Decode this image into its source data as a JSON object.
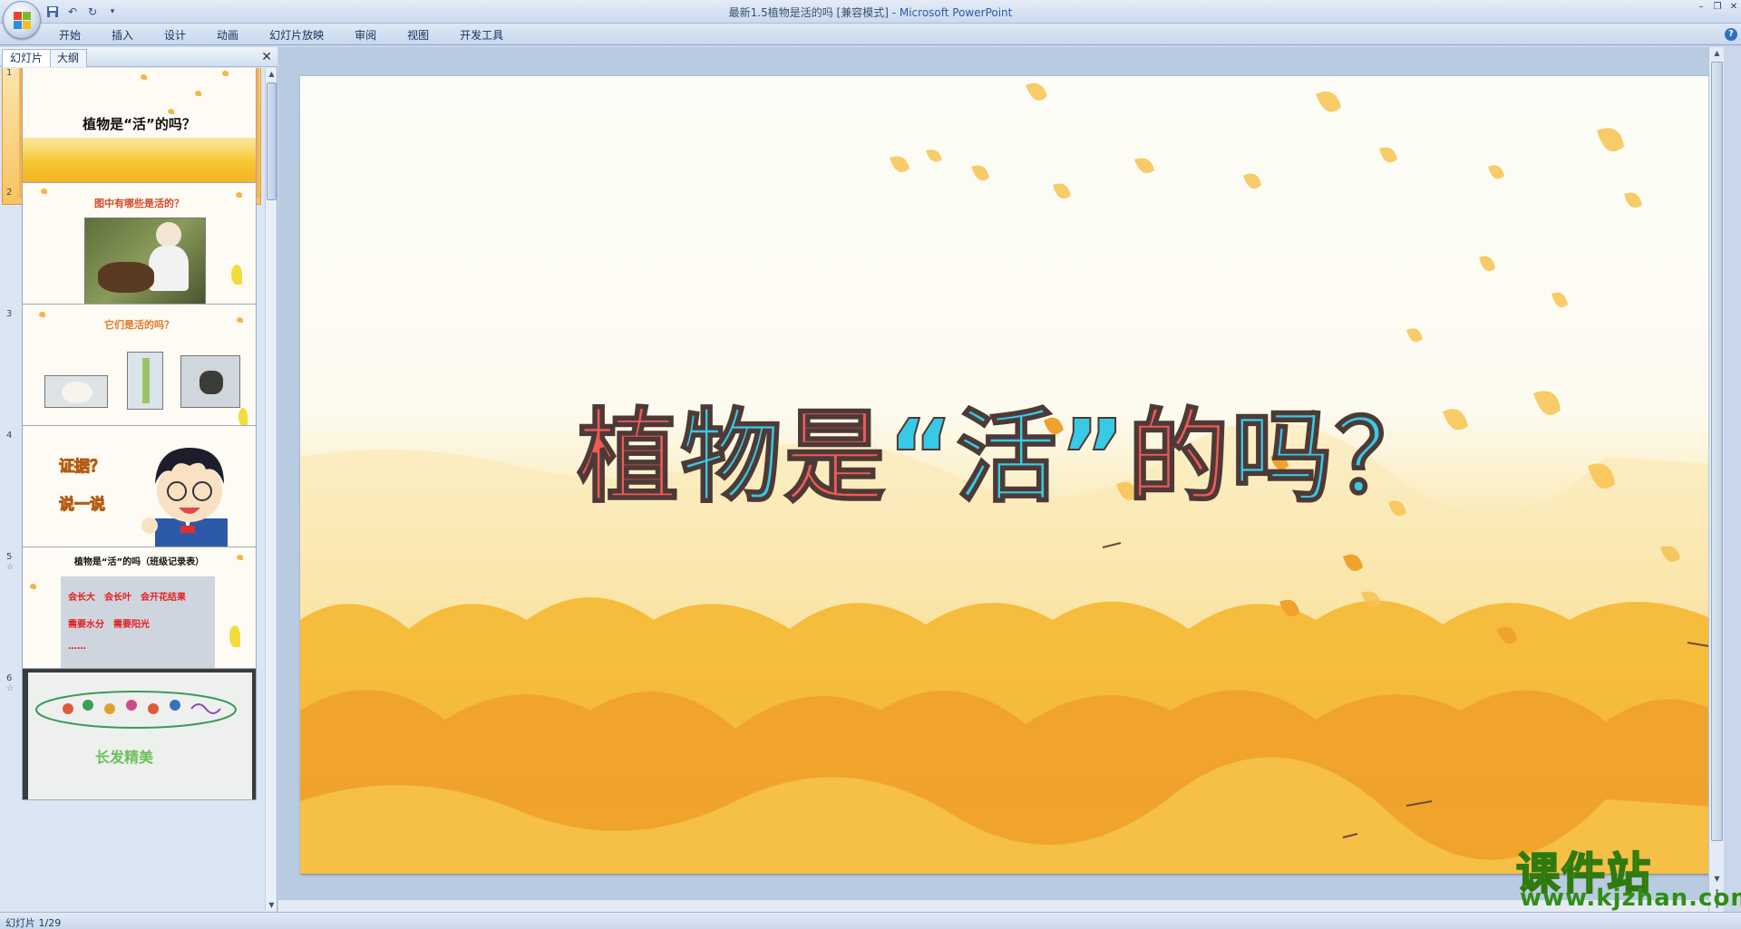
{
  "window": {
    "title_doc": "最新1.5植物是活的吗 [兼容模式]",
    "title_sep": " - ",
    "title_app": "Microsoft PowerPoint"
  },
  "ribbon": {
    "tabs": [
      "开始",
      "插入",
      "设计",
      "动画",
      "幻灯片放映",
      "审阅",
      "视图",
      "开发工具"
    ]
  },
  "pane": {
    "tab_slides": "幻灯片",
    "tab_outline": "大纲"
  },
  "thumbnails": [
    {
      "number": "1",
      "title": "植物是“活”的吗？"
    },
    {
      "number": "2",
      "title": "图中有哪些是活的？"
    },
    {
      "number": "3",
      "title": "它们是活的吗？"
    },
    {
      "number": "4",
      "line1": "证据？",
      "line2": "说一说"
    },
    {
      "number": "5",
      "title": "植物是“活”的吗（班级记录表）",
      "row1": "会长大　会长叶　会开花结果",
      "row2": "需要水分　需要阳光",
      "row3": "……"
    },
    {
      "number": "6",
      "caption": "长发精美"
    }
  ],
  "slide": {
    "title_parts": [
      {
        "text": "植",
        "color": "red"
      },
      {
        "text": "物",
        "color": "blue"
      },
      {
        "text": "是",
        "color": "red"
      },
      {
        "text": "“活”",
        "color": "blue"
      },
      {
        "text": "的",
        "color": "red"
      },
      {
        "text": "吗",
        "color": "blue"
      },
      {
        "text": "？",
        "color": "blue"
      }
    ]
  },
  "watermark": {
    "cn": "课件站",
    "url": "www.kjzhan.com"
  },
  "status": {
    "slide_info": "幻灯片 1/29"
  },
  "colors": {
    "title_red": "#ef5a5a",
    "title_blue": "#37c9e6",
    "selection": "#f7b34a"
  }
}
